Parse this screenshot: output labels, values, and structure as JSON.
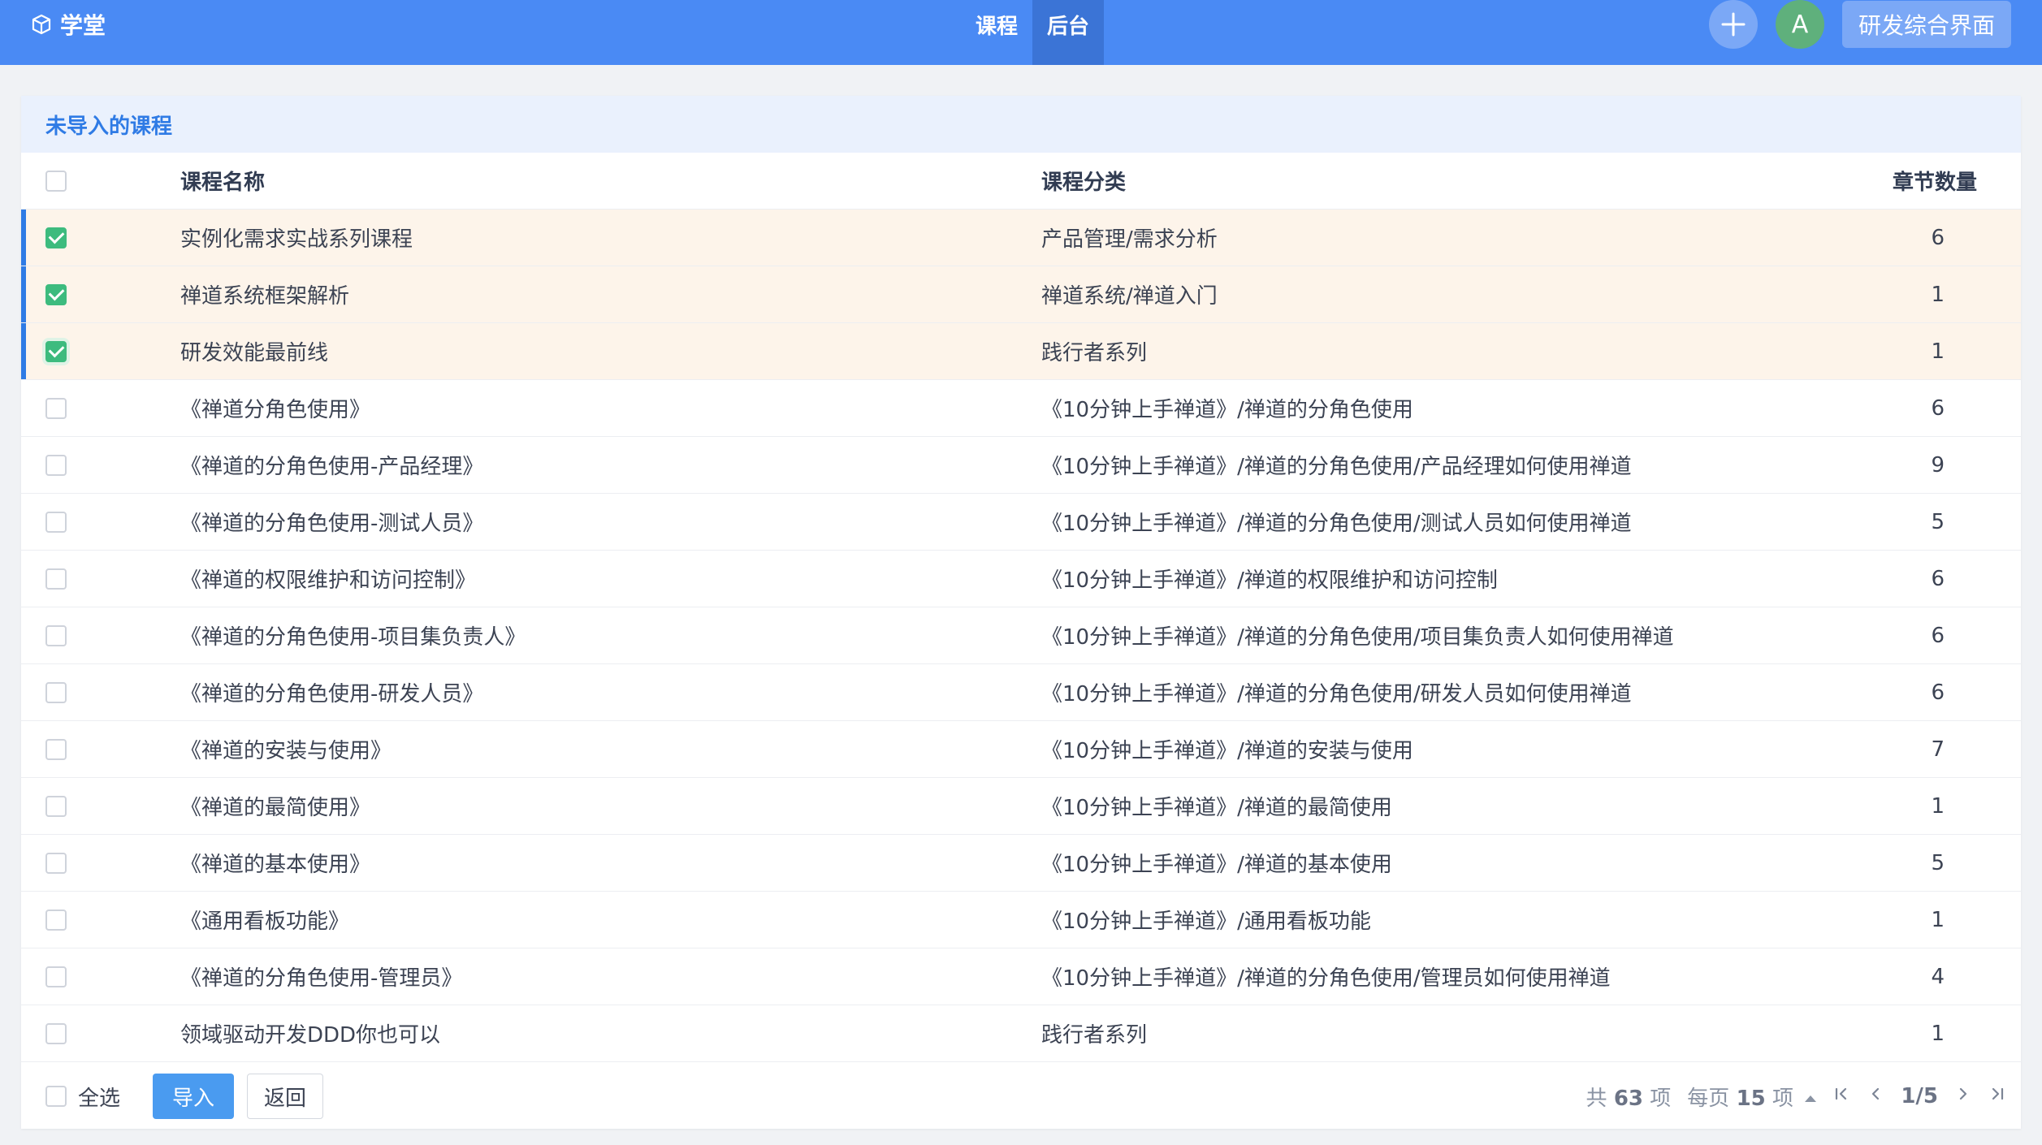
{
  "navbar": {
    "brand": "学堂",
    "tabs": [
      {
        "label": "课程",
        "active": false
      },
      {
        "label": "后台",
        "active": true
      }
    ],
    "avatar_letter": "A",
    "project_button": "研发综合界面"
  },
  "panel": {
    "title": "未导入的课程",
    "columns": {
      "name": "课程名称",
      "category": "课程分类",
      "chapters": "章节数量"
    },
    "rows": [
      {
        "name": "实例化需求实战系列课程",
        "category": "产品管理/需求分析",
        "chapters": "6",
        "checked": true
      },
      {
        "name": "禅道系统框架解析",
        "category": "禅道系统/禅道入门",
        "chapters": "1",
        "checked": true
      },
      {
        "name": "研发效能最前线",
        "category": "践行者系列",
        "chapters": "1",
        "checked": true
      },
      {
        "name": "《禅道分角色使用》",
        "category": "《10分钟上手禅道》/禅道的分角色使用",
        "chapters": "6",
        "checked": false
      },
      {
        "name": "《禅道的分角色使用-产品经理》",
        "category": "《10分钟上手禅道》/禅道的分角色使用/产品经理如何使用禅道",
        "chapters": "9",
        "checked": false
      },
      {
        "name": "《禅道的分角色使用-测试人员》",
        "category": "《10分钟上手禅道》/禅道的分角色使用/测试人员如何使用禅道",
        "chapters": "5",
        "checked": false
      },
      {
        "name": "《禅道的权限维护和访问控制》",
        "category": "《10分钟上手禅道》/禅道的权限维护和访问控制",
        "chapters": "6",
        "checked": false
      },
      {
        "name": "《禅道的分角色使用-项目集负责人》",
        "category": "《10分钟上手禅道》/禅道的分角色使用/项目集负责人如何使用禅道",
        "chapters": "6",
        "checked": false
      },
      {
        "name": "《禅道的分角色使用-研发人员》",
        "category": "《10分钟上手禅道》/禅道的分角色使用/研发人员如何使用禅道",
        "chapters": "6",
        "checked": false
      },
      {
        "name": "《禅道的安装与使用》",
        "category": "《10分钟上手禅道》/禅道的安装与使用",
        "chapters": "7",
        "checked": false
      },
      {
        "name": "《禅道的最简使用》",
        "category": "《10分钟上手禅道》/禅道的最简使用",
        "chapters": "1",
        "checked": false
      },
      {
        "name": "《禅道的基本使用》",
        "category": "《10分钟上手禅道》/禅道的基本使用",
        "chapters": "5",
        "checked": false
      },
      {
        "name": "《通用看板功能》",
        "category": "《10分钟上手禅道》/通用看板功能",
        "chapters": "1",
        "checked": false
      },
      {
        "name": "《禅道的分角色使用-管理员》",
        "category": "《10分钟上手禅道》/禅道的分角色使用/管理员如何使用禅道",
        "chapters": "4",
        "checked": false
      },
      {
        "name": "领域驱动开发DDD你也可以",
        "category": "践行者系列",
        "chapters": "1",
        "checked": false
      }
    ]
  },
  "footer": {
    "select_all_label": "全选",
    "import_button": "导入",
    "back_button": "返回",
    "total_prefix": "共",
    "total_count": "63",
    "total_suffix": "项",
    "per_page_prefix": "每页",
    "per_page_count": "15",
    "per_page_suffix": "项",
    "page_indicator": "1/5"
  }
}
